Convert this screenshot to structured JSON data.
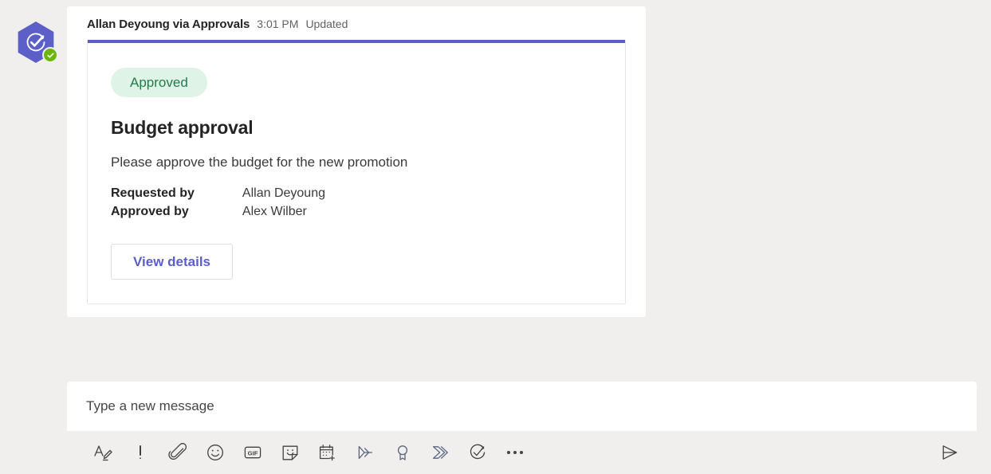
{
  "message": {
    "avatar": {
      "icon": "approvals-app-icon",
      "hex_color": "#5b5fc7",
      "presence": "available",
      "presence_color": "#6bb700"
    },
    "author": "Allan Deyoung via Approvals",
    "time": "3:01 PM",
    "status": "Updated"
  },
  "card": {
    "accent_color": "#5b5fc7",
    "status_pill": {
      "label": "Approved",
      "bg_color": "#dff3e7",
      "text_color": "#237b4b"
    },
    "title": "Budget approval",
    "description": "Please approve the budget for the new promotion",
    "facts": [
      {
        "name": "Requested by",
        "value": "Allan Deyoung"
      },
      {
        "name": "Approved by",
        "value": "Alex Wilber"
      }
    ],
    "action_label": "View details",
    "action_color": "#5b5fc7"
  },
  "compose": {
    "placeholder": "Type a new message",
    "value": "",
    "toolbar": [
      {
        "name": "format-icon",
        "label": "Format"
      },
      {
        "name": "important-icon",
        "label": "Set delivery options"
      },
      {
        "name": "attach-icon",
        "label": "Attach"
      },
      {
        "name": "emoji-icon",
        "label": "Emoji"
      },
      {
        "name": "gif-icon",
        "label": "GIF"
      },
      {
        "name": "sticker-icon",
        "label": "Sticker"
      },
      {
        "name": "schedule-meeting-icon",
        "label": "Schedule a meeting"
      },
      {
        "name": "stream-icon",
        "label": "Stream"
      },
      {
        "name": "praise-icon",
        "label": "Praise"
      },
      {
        "name": "forms-icon",
        "label": "Forms"
      },
      {
        "name": "approvals-icon",
        "label": "Approvals"
      },
      {
        "name": "more-options-icon",
        "label": "More options"
      }
    ],
    "send_label": "Send"
  }
}
